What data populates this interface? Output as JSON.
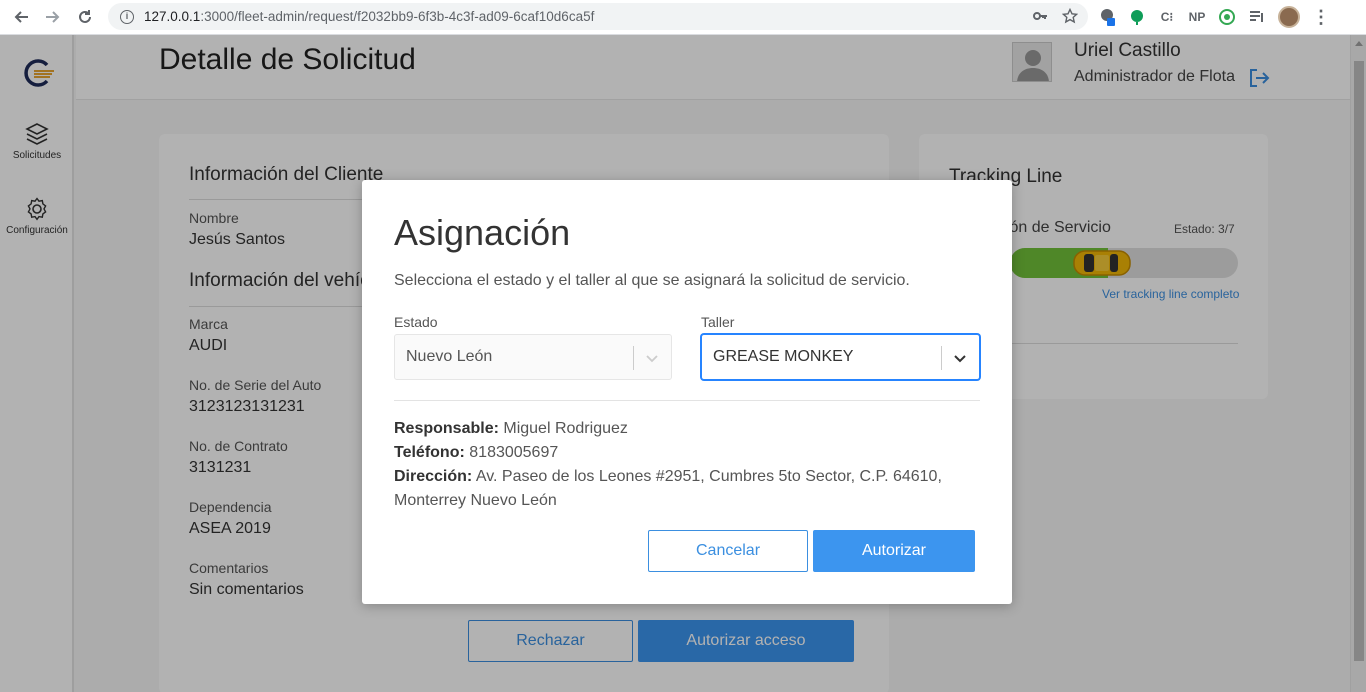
{
  "browser": {
    "url_host": "127.0.0.1",
    "url_path": ":3000/fleet-admin/request/f2032bb9-6f3b-4c3f-ad09-6caf10d6ca5f",
    "extensions": [
      "C⁝",
      "NP"
    ]
  },
  "sidebar": {
    "items": [
      {
        "label": "Solicitudes",
        "icon": "layers-icon"
      },
      {
        "label": "Configuración",
        "icon": "gear-icon"
      }
    ]
  },
  "header": {
    "title": "Detalle de Solicitud",
    "user_name": "Uriel Castillo",
    "user_role": "Administrador de Flota"
  },
  "client": {
    "section_title": "Información del Cliente",
    "name_label": "Nombre",
    "name_value": "Jesús Santos"
  },
  "vehicle": {
    "section_title": "Información del vehículo",
    "brand_label": "Marca",
    "brand_value": "AUDI",
    "serial_label": "No. de Serie del Auto",
    "serial_value": "3123123131231",
    "contract_label": "No. de Contrato",
    "contract_value": "3131231",
    "dependency_label": "Dependencia",
    "dependency_value": "ASEA 2019",
    "comments_label": "Comentarios",
    "comments_value": "Sin comentarios"
  },
  "actions": {
    "reject_label": "Rechazar",
    "authorize_access_label": "Autorizar acceso"
  },
  "tracking": {
    "title": "Tracking Line",
    "step_label": "Asignación de Servicio",
    "state_label": "Estado: 3/7",
    "progress": 0.43,
    "link_label": "Ver tracking line completo"
  },
  "modal": {
    "title": "Asignación",
    "subtitle": "Selecciona el estado y el taller al que se asignará la solicitud de servicio.",
    "state_label": "Estado",
    "state_value": "Nuevo León",
    "workshop_label": "Taller",
    "workshop_value": "GREASE MONKEY",
    "responsible_label": "Responsable:",
    "responsible_value": "Miguel Rodriguez",
    "phone_label": "Teléfono:",
    "phone_value": "8183005697",
    "address_label": "Dirección:",
    "address_value_1": "Av. Paseo de los Leones #2951, Cumbres 5to Sector, C.P. 64610,",
    "address_value_2": "Monterrey Nuevo León",
    "cancel_label": "Cancelar",
    "authorize_label": "Autorizar"
  },
  "colors": {
    "accent": "#3c95ef",
    "progress": "#71c23a"
  }
}
